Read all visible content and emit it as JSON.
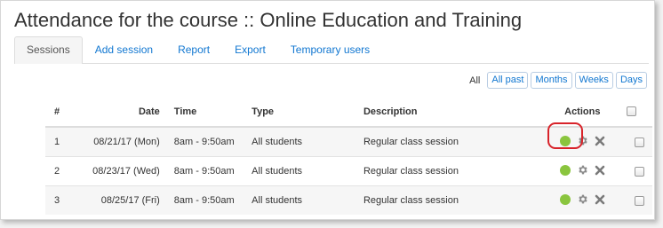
{
  "page": {
    "title": "Attendance for the course :: Online Education and Training"
  },
  "tabs": [
    {
      "label": "Sessions",
      "active": true
    },
    {
      "label": "Add session",
      "active": false
    },
    {
      "label": "Report",
      "active": false
    },
    {
      "label": "Export",
      "active": false
    },
    {
      "label": "Temporary users",
      "active": false
    }
  ],
  "filters": {
    "current_label": "All",
    "buttons": [
      "All past",
      "Months",
      "Weeks",
      "Days"
    ]
  },
  "table": {
    "headers": {
      "num": "#",
      "date": "Date",
      "time": "Time",
      "type": "Type",
      "description": "Description",
      "actions": "Actions"
    },
    "rows": [
      {
        "num": "1",
        "date": "08/21/17 (Mon)",
        "time": "8am - 9:50am",
        "type": "All students",
        "description": "Regular class session",
        "highlighted": true
      },
      {
        "num": "2",
        "date": "08/23/17 (Wed)",
        "time": "8am - 9:50am",
        "type": "All students",
        "description": "Regular class session",
        "highlighted": false
      },
      {
        "num": "3",
        "date": "08/25/17 (Fri)",
        "time": "8am - 9:50am",
        "type": "All students",
        "description": "Regular class session",
        "highlighted": false
      }
    ],
    "action_icons": [
      "take-attendance-icon",
      "gear-icon",
      "close-icon"
    ]
  },
  "colors": {
    "link": "#1177d1",
    "take_attendance": "#8ac53e",
    "highlight": "#d8232a"
  }
}
